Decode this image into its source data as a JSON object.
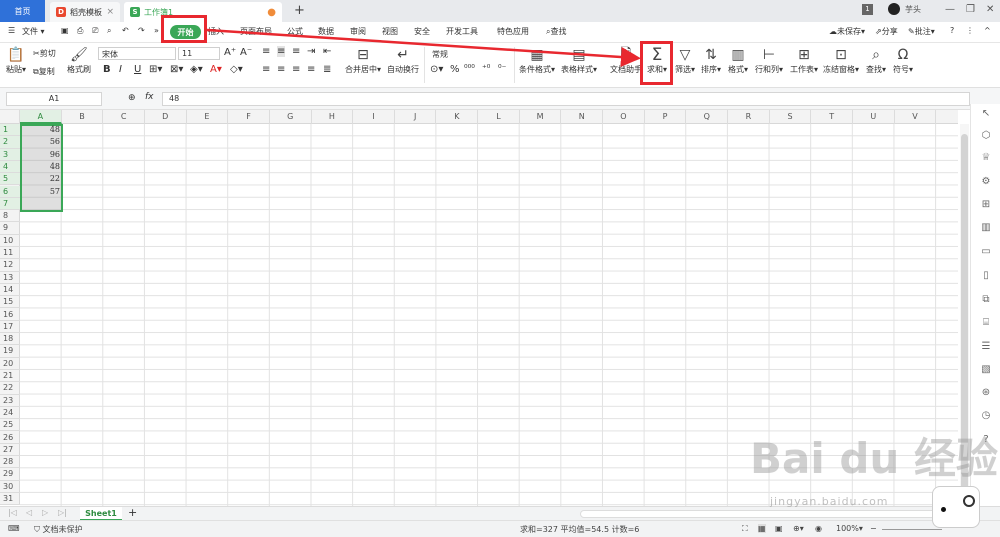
{
  "tabs": {
    "home": "首页",
    "template": "稻壳模板",
    "workbook": "工作簿1",
    "new_tab": "+"
  },
  "user": {
    "badge": "1",
    "name": "芋头"
  },
  "menu": {
    "file": "文件",
    "items": [
      "插入",
      "页面布局",
      "公式",
      "数据",
      "审阅",
      "视图",
      "安全",
      "开发工具",
      "特色应用"
    ],
    "start": "开始",
    "search": "查找",
    "unsaved": "未保存",
    "share": "分享",
    "comment": "批注"
  },
  "ribbon": {
    "paste": "粘贴",
    "cut": "剪切",
    "copy": "复制",
    "format_painter": "格式刷",
    "font_name": "宋体",
    "font_size": "11",
    "merge_center": "合并居中",
    "wrap_text": "自动换行",
    "number_format": "常规",
    "conditional_format": "条件格式",
    "table_style": "表格样式",
    "doc_assistant": "文档助手",
    "sum": "求和",
    "filter": "筛选",
    "sort": "排序",
    "format": "格式",
    "rows_cols": "行和列",
    "worksheet": "工作表",
    "freeze": "冻结窗格",
    "find": "查找",
    "symbol": "符号"
  },
  "formula_bar": {
    "name_box": "A1",
    "fx": "fx",
    "value": "48"
  },
  "columns": [
    "A",
    "B",
    "C",
    "D",
    "E",
    "F",
    "G",
    "H",
    "I",
    "J",
    "K",
    "L",
    "M",
    "N",
    "O",
    "P",
    "Q",
    "R",
    "S",
    "T",
    "U",
    "V"
  ],
  "rows": [
    "1",
    "2",
    "3",
    "4",
    "5",
    "6",
    "7",
    "8",
    "9",
    "10",
    "11",
    "12",
    "13",
    "14",
    "15",
    "16",
    "17",
    "18",
    "19",
    "20",
    "21",
    "22",
    "23",
    "24",
    "25",
    "26",
    "27",
    "28",
    "29",
    "30",
    "31"
  ],
  "cells_A": [
    "48",
    "56",
    "96",
    "48",
    "22",
    "57"
  ],
  "sheet": {
    "name": "Sheet1",
    "add": "+"
  },
  "status": {
    "protect": "文档未保护",
    "summary": "求和=327  平均值=54.5  计数=6",
    "zoom": "100%"
  },
  "watermark": {
    "brand": "Bai du 经验",
    "url": "jingyan.baidu.com"
  },
  "colors": {
    "accent_green": "#3aa757",
    "home_blue": "#2f71d9",
    "annotation_red": "#e8282f"
  }
}
